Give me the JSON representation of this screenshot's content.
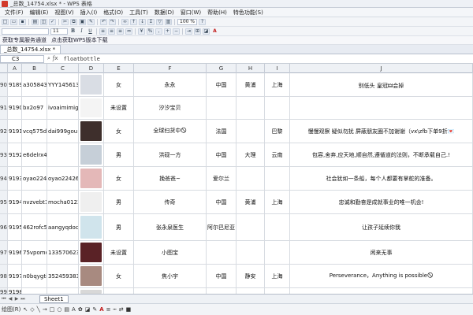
{
  "window": {
    "title": "_总数_14754.xlsx * - WPS 表格"
  },
  "menu": [
    "文件(F)",
    "编辑(E)",
    "视图(V)",
    "插入(I)",
    "格式(O)",
    "工具(T)",
    "数据(D)",
    "窗口(W)",
    "帮助(H)",
    "特色功能(S)"
  ],
  "toolbar": {
    "zoom": "100 %",
    "font_size": "11",
    "bold": "B",
    "italic": "I",
    "underline": "U",
    "font_color": "A"
  },
  "promo": {
    "left": "获取专属服务通道",
    "right": "点击获取WPS版本下载"
  },
  "doc_tab": {
    "label": "_总数_14754.xlsx *"
  },
  "formula_bar": {
    "cell_ref": "C3",
    "formula": "floatbottle"
  },
  "columns": [
    "A",
    "B",
    "C",
    "D",
    "E",
    "F",
    "G",
    "H",
    "I",
    "J"
  ],
  "rows": [
    {
      "num": "90",
      "a": "9189",
      "b": "a3058437",
      "c": "YYY145613",
      "e": "女",
      "f": "永永",
      "g": "中国",
      "h": "黄浦",
      "i": "上海",
      "j": "别低头 皇冠🜲会掉",
      "photo": "#d9dde4"
    },
    {
      "num": "91",
      "a": "9190",
      "b": "bx2o97",
      "c": "ivoaimimigo",
      "e": "未设置",
      "f": "汐汐宝贝",
      "g": "",
      "h": "",
      "i": "",
      "j": "",
      "photo": "#f4f4f4"
    },
    {
      "num": "92",
      "a": "9191",
      "b": "vcq575d2",
      "c": "dai999gou",
      "e": "女",
      "f": "全球扫货中🛇",
      "g": "法国",
      "h": "",
      "i": "巴黎",
      "j": "慢慢观察 疑似勿扰 屏蔽朋友圈不加谢谢（vx\\zfb下单9折💌",
      "photo": "#3e2f2c"
    },
    {
      "num": "93",
      "a": "9192",
      "b": "e6delrx4v",
      "c": "",
      "e": "男",
      "f": "洪砚一方",
      "g": "中国",
      "h": "大理",
      "i": "云南",
      "j": "包容,舍弃,应天地,顺自然,遵循道的法则，不断承载自己.!",
      "photo": "#c6cfd8"
    },
    {
      "num": "94",
      "a": "9193",
      "b": "oyao2242",
      "c": "oyao22426",
      "e": "女",
      "f": "挽爸爸~",
      "g": "爱尔兰",
      "h": "",
      "i": "",
      "j": "社会犹如一条船，每个人都要有掌舵的准备。",
      "photo": "#e4b8b8"
    },
    {
      "num": "95",
      "a": "9194",
      "b": "nvzvebt1",
      "c": "mocha0123",
      "e": "男",
      "f": "传奇",
      "g": "中国",
      "h": "黄浦",
      "i": "上海",
      "j": "忠诚和勤奋是成就事业的唯一机会!",
      "photo": "#efefef"
    },
    {
      "num": "96",
      "a": "9195",
      "b": "462rofc57",
      "c": "aangyqdoct",
      "e": "男",
      "f": "张永泉医生",
      "g": "阿尔巴尼亚",
      "h": "",
      "i": "",
      "j": "让孩子延续你我",
      "photo": "#d0e4ec"
    },
    {
      "num": "97",
      "a": "9196",
      "b": "75vpomdl",
      "c": "133570623",
      "e": "未设置",
      "f": "小图宝",
      "g": "",
      "h": "",
      "i": "",
      "j": "闲来无事",
      "photo": "#5a2226"
    },
    {
      "num": "98",
      "a": "9197",
      "b": "n0bqygtiq",
      "c": "352459383",
      "e": "女",
      "f": "焦小宇",
      "g": "中国",
      "h": "静安",
      "i": "上海",
      "j": "Perseverance，Anything is possible🛇",
      "photo": "#a88a80"
    },
    {
      "num": "99",
      "a": "9198",
      "b": "",
      "c": "",
      "e": "",
      "f": "",
      "g": "",
      "h": "",
      "i": "",
      "j": "",
      "photo": "#d8d8d8"
    }
  ],
  "sheet_tab": {
    "label": "Sheet1"
  },
  "drawbar": {
    "label": "绘图(R)"
  }
}
